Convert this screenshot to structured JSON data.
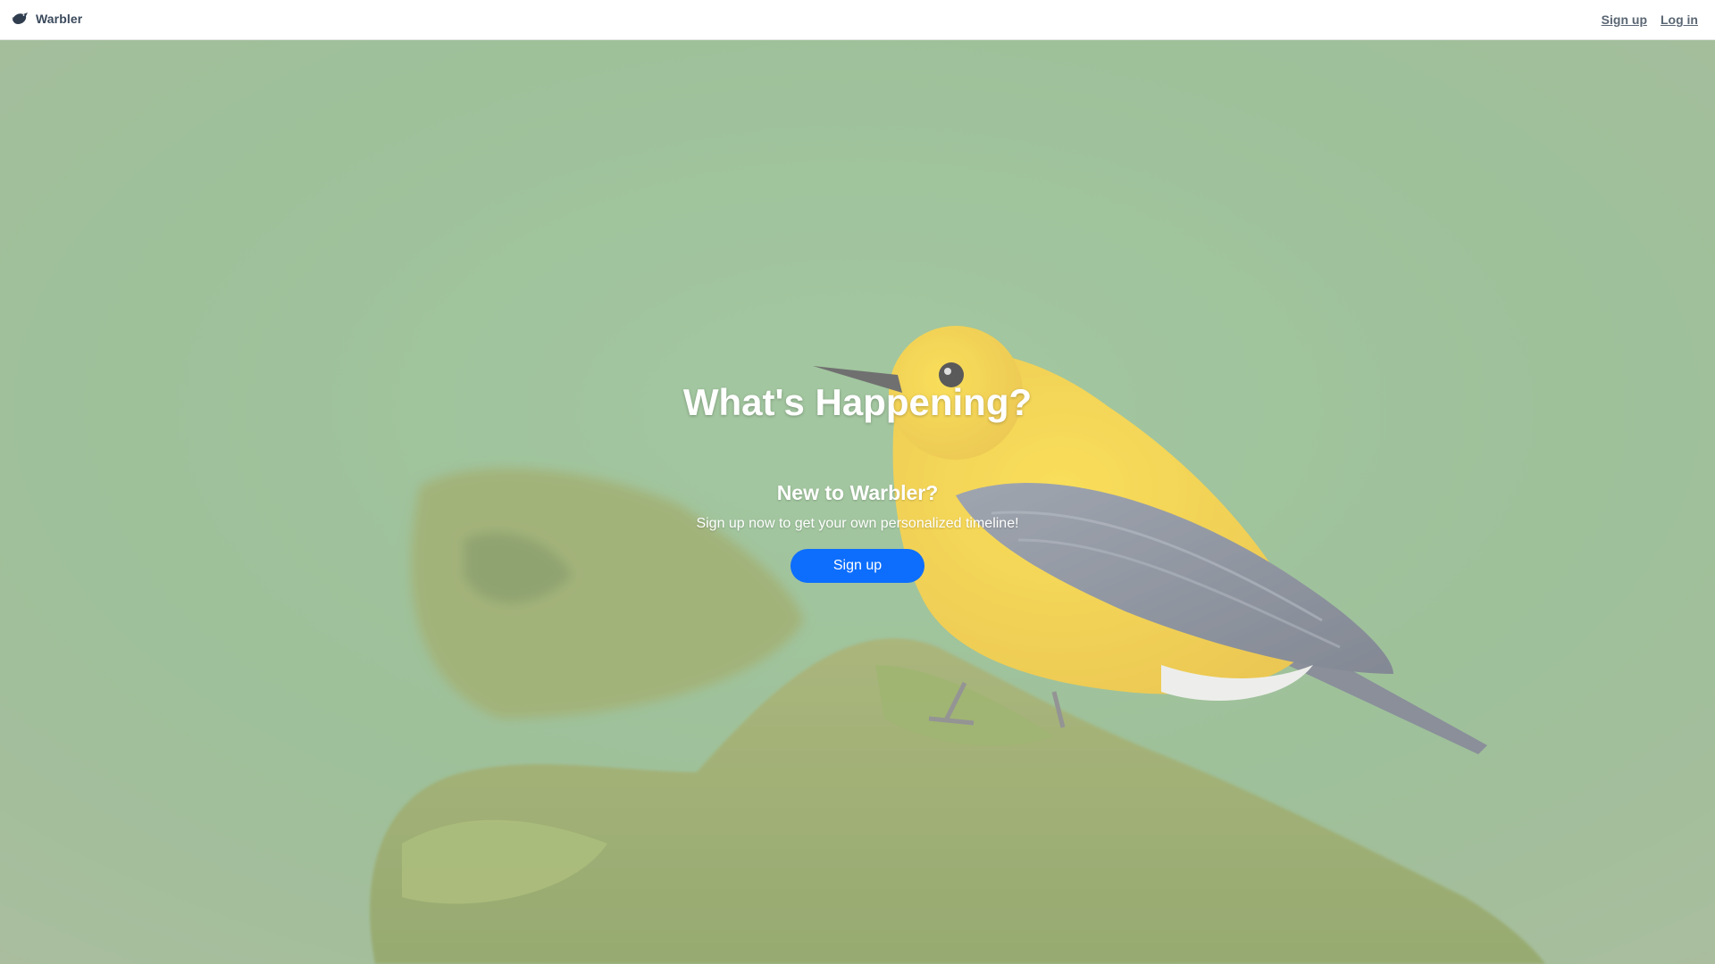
{
  "navbar": {
    "brand_name": "Warbler",
    "brand_icon": "bird-logo-icon",
    "links": [
      {
        "label": "Sign up"
      },
      {
        "label": "Log in"
      }
    ]
  },
  "hero": {
    "title": "What's Happening?",
    "subtitle": "New to Warbler?",
    "text": "Sign up now to get your own personalized timeline!",
    "button_label": "Sign up",
    "background_image": "yellow-warbler-on-moss-photo",
    "colors": {
      "button": "#0d6efd",
      "bird_yellow": "#f0c41c",
      "bird_wing": "#6b7382",
      "moss": "#8aa04c",
      "background": "#8fb886"
    }
  }
}
